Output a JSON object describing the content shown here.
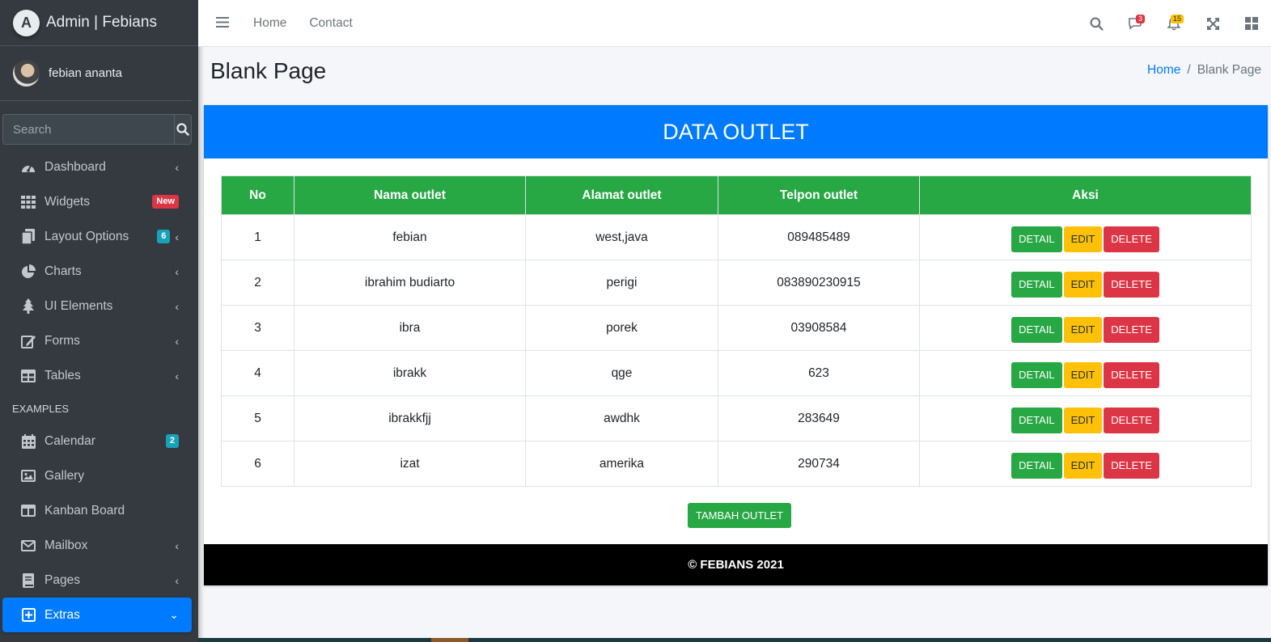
{
  "brand": {
    "logo_letter": "A",
    "title": "Admin | Febians"
  },
  "user": {
    "name": "febian ananta"
  },
  "search": {
    "placeholder": "Search"
  },
  "sidebar": {
    "items": [
      {
        "label": "Dashboard",
        "icon": "tachometer-icon"
      },
      {
        "label": "Widgets",
        "icon": "grid-icon",
        "badge": "New"
      },
      {
        "label": "Layout Options",
        "icon": "copy-icon",
        "badge": "6"
      },
      {
        "label": "Charts",
        "icon": "pie-chart-icon"
      },
      {
        "label": "UI Elements",
        "icon": "tree-icon"
      },
      {
        "label": "Forms",
        "icon": "edit-icon"
      },
      {
        "label": "Tables",
        "icon": "table-icon"
      }
    ],
    "header": "EXAMPLES",
    "examples": [
      {
        "label": "Calendar",
        "icon": "calendar-icon",
        "badge": "2"
      },
      {
        "label": "Gallery",
        "icon": "image-icon"
      },
      {
        "label": "Kanban Board",
        "icon": "columns-icon"
      },
      {
        "label": "Mailbox",
        "icon": "envelope-icon"
      },
      {
        "label": "Pages",
        "icon": "book-icon"
      },
      {
        "label": "Extras",
        "icon": "plus-square-icon",
        "active": true
      }
    ]
  },
  "topnav": {
    "links": [
      "Home",
      "Contact"
    ],
    "messages_count": "3",
    "notifications_count": "15"
  },
  "page": {
    "title": "Blank Page",
    "breadcrumb": [
      "Home",
      "Blank Page"
    ]
  },
  "card": {
    "title": "DATA OUTLET",
    "columns": [
      "No",
      "Nama outlet",
      "Alamat outlet",
      "Telpon outlet",
      "Aksi"
    ],
    "rows": [
      [
        "1",
        "febian",
        "west,java",
        "089485489"
      ],
      [
        "2",
        "ibrahim budiarto",
        "perigi",
        "083890230915"
      ],
      [
        "3",
        "ibra",
        "porek",
        "03908584"
      ],
      [
        "4",
        "ibrakk",
        "qge",
        "623"
      ],
      [
        "5",
        "ibrakkfjj",
        "awdhk",
        "283649"
      ],
      [
        "6",
        "izat",
        "amerika",
        "290734"
      ]
    ],
    "actions": {
      "detail": "DETAIL",
      "edit": "EDIT",
      "delete": "DELETE"
    },
    "add_button": "TAMBAH OUTLET",
    "footer": "© FEBIANS 2021"
  },
  "colors": {
    "primary": "#007bff",
    "success": "#28a745",
    "warning": "#ffc107",
    "danger": "#dc3545",
    "sidebar": "#343a40"
  }
}
